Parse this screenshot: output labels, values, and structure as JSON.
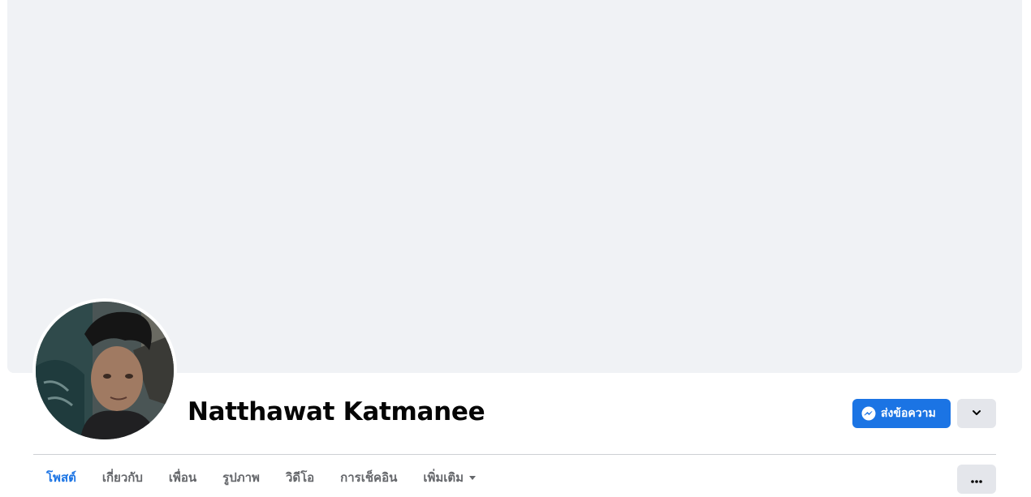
{
  "profile": {
    "name": "Natthawat Katmanee",
    "avatar_alt": "profile-photo"
  },
  "actions": {
    "message_label": "ส่งข้อความ",
    "message_icon": "messenger-icon",
    "expand_icon": "chevron-down-icon",
    "more_icon": "ellipsis-icon"
  },
  "tabs": [
    {
      "label": "โพสต์",
      "active": true
    },
    {
      "label": "เกี่ยวกับ",
      "active": false
    },
    {
      "label": "เพื่อน",
      "active": false
    },
    {
      "label": "รูปภาพ",
      "active": false
    },
    {
      "label": "วิดีโอ",
      "active": false
    },
    {
      "label": "การเช็คอิน",
      "active": false
    },
    {
      "label": "เพิ่มเติม",
      "active": false
    }
  ],
  "colors": {
    "accent": "#1b74e4",
    "cover": "#f0f2f5",
    "button_secondary": "#e4e6eb",
    "text_primary": "#050505",
    "text_secondary": "#65676b"
  }
}
